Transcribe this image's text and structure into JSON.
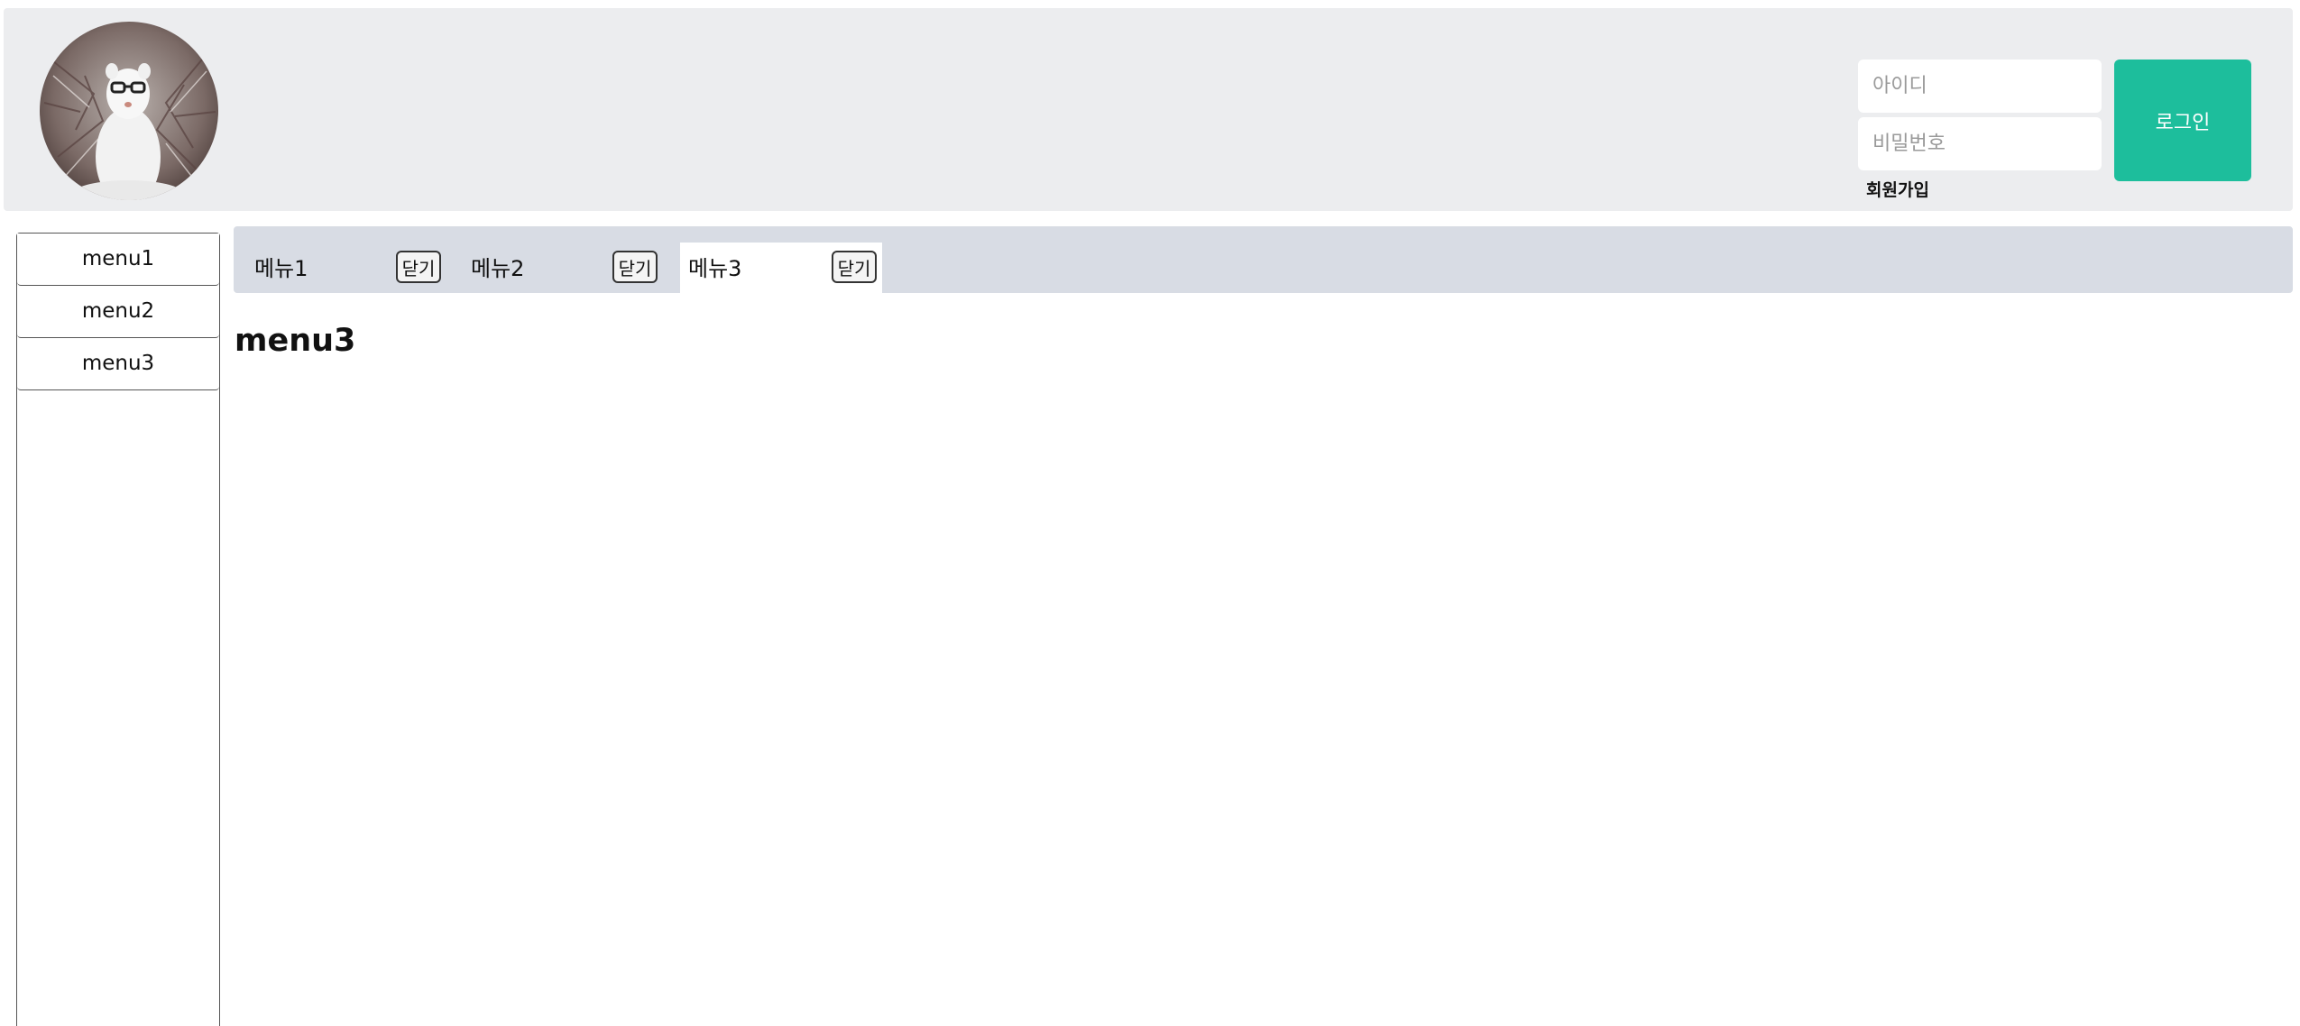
{
  "header": {
    "avatar_icon": "avatar-ermine-photo"
  },
  "login": {
    "id_placeholder": "아이디",
    "password_placeholder": "비밀번호",
    "signup_label": "회원가입",
    "login_label": "로그인",
    "accent_color": "#1dbe9c"
  },
  "sidebar": {
    "items": [
      {
        "label": "menu1"
      },
      {
        "label": "menu2"
      },
      {
        "label": "menu3"
      }
    ]
  },
  "tabs": {
    "items": [
      {
        "label": "메뉴1",
        "close_label": "닫기",
        "active": false
      },
      {
        "label": "메뉴2",
        "close_label": "닫기",
        "active": false
      },
      {
        "label": "메뉴3",
        "close_label": "닫기",
        "active": true
      }
    ]
  },
  "content": {
    "title": "menu3"
  }
}
